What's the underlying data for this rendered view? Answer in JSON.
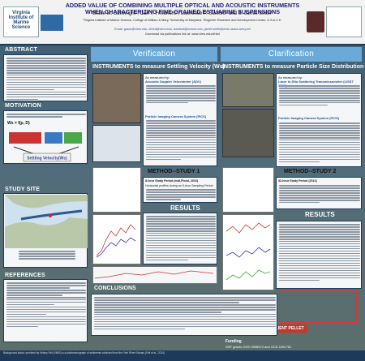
{
  "header": {
    "title": "ADDED VALUE OF COMBINING MULTIPLE OPTICAL AND ACOUSTIC INSTRUMENTS WHEN CHARACTERIZING FINE-GRAINED ESTUARINE SUSPENSIONS",
    "authors": "Grace M. Cartwright¹, Carl T. Friedrichs¹, Lawrence P. Sanford² and S. Jarrell Smith³",
    "affiliations": "¹Virginia Institute of Marine Science, College of William & Mary, ²University of Maryland, ³Engineer Research and Development Center, U.S.A.C.E.",
    "email": "Email: grace@vims.edu, cfried@vims.edu, lsanford@umces.edu, jarrell.smith@erdc.usace.army.mil",
    "download": "Download via publications link at: www.vims.edu/cfried",
    "logo_left_text": "Virginia Institute of Marine Science"
  },
  "sections": {
    "abstract": "ABSTRACT",
    "motivation": "MOTIVATION",
    "study_site": "STUDY SITE",
    "references": "REFERENCES",
    "verification": "Verification",
    "clarification": "Clarification",
    "instruments_ws": "INSTRUMENTS to measure Settling Velocity (Ws)",
    "instruments_psd": "INSTRUMENTS to measure Particle Size Distribution",
    "method1": "METHOD--STUDY 1",
    "method2": "METHOD--STUDY 2",
    "results1": "RESULTS",
    "results2": "RESULTS",
    "conclusions": "CONCLUSIONS",
    "resilient_pellet": "RESILIENT PELLET",
    "funding": "Funding",
    "funding_detail": "NSF grants OCE-0536572 and OCE-1061781",
    "background": "Background photo: provided by Kelsey Fall (VIMS) is a photomicrograph of sediments collected from the York River Estuary (Fall et al., 2014)"
  },
  "motivation": {
    "equation_left": "Ws = f(ρ, D)",
    "settling_label": "Settling Velocity(Ws)"
  },
  "method1": {
    "subtitle": "8-hour Study Period (mid-Flood, 2016)",
    "note": "Horizontal profiles during an 8-hour Sampling Period"
  },
  "method2": {
    "subtitle": "32-hour Study Period (2014)"
  },
  "ws_instruments": {
    "measured_by": "As measured by:",
    "a": "Acoustic Doppler Velocimeter (ADV)",
    "b": "Particle Imaging Camera System (PICS)"
  },
  "psd_instruments": {
    "measured_by": "As measured by:",
    "a": "Laser In-Situ Scattering Transmissometer (LISST 100X)",
    "b": "Particle Imaging Camera System (PICS)"
  }
}
